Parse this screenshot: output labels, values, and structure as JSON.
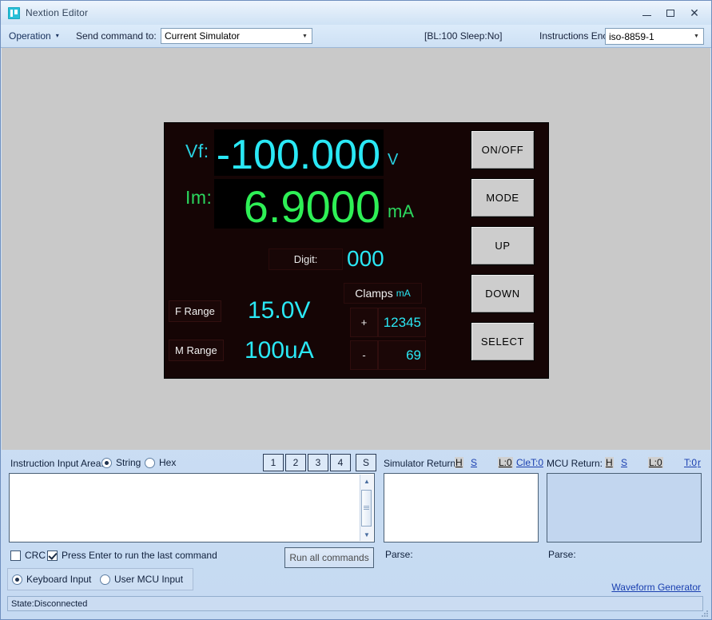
{
  "window": {
    "title": "Nextion Editor",
    "icon": "nextion-logo-icon",
    "minimize": "—",
    "maximize": "□",
    "close": "✕"
  },
  "toolbar": {
    "operation_menu": "Operation",
    "caret": "▾",
    "send_command_label": "Send command to:",
    "target_value": "Current Simulator",
    "status_info": "[BL:100  Sleep:No]",
    "encoding_label": "Instructions Encoding:",
    "encoding_value": "iso-8859-1",
    "combo_arrow": "▼"
  },
  "simulator": {
    "vf_label": "Vf:",
    "vf_value": "-100.000",
    "vf_unit": "V",
    "im_label": "Im:",
    "im_value": "6.9000",
    "im_unit": "mA",
    "digit_label": "Digit:",
    "digit_value": "000",
    "clamps_label": "Clamps",
    "clamps_unit": "mA",
    "clamp_plus_sign": "+",
    "clamp_plus_value": "12345",
    "clamp_minus_sign": "-",
    "clamp_minus_value": "69",
    "f_range_label": "F Range",
    "f_range_value": "15.0V",
    "m_range_label": "M Range",
    "m_range_value": "100uA",
    "buttons": [
      {
        "label": "ON/OFF"
      },
      {
        "label": "MODE"
      },
      {
        "label": "UP"
      },
      {
        "label": "DOWN"
      },
      {
        "label": "SELECT"
      }
    ],
    "colors": {
      "screen_bg": "#150505",
      "cyan": "#2ae8f5",
      "green": "#2ef056",
      "button_face": "#cdcdcd"
    }
  },
  "instruction_panel": {
    "label": "Instruction Input Area:",
    "mode_string": "String",
    "mode_hex": "Hex",
    "selected_mode": "String",
    "input_value": "",
    "quick_buttons": [
      "1",
      "2",
      "3",
      "4",
      "S"
    ],
    "scroll_up": "▲",
    "scroll_down": "▼"
  },
  "simulator_return": {
    "label": "Simulator Return:",
    "btn_h": "H",
    "btn_s": "S",
    "len": "L:0",
    "clear": "Cle",
    "time": "T:0",
    "content": "",
    "parse_label": "Parse:"
  },
  "mcu_return": {
    "label": "MCU Return:",
    "btn_h": "H",
    "btn_s": "S",
    "len": "L:0",
    "time": "T:0",
    "extra": "r",
    "content": "",
    "parse_label": "Parse:"
  },
  "options": {
    "crc_label": "CRC",
    "crc_checked": false,
    "enter_label": "Press Enter to run the last command",
    "enter_checked": true,
    "run_all_label": "Run all commands",
    "keyboard_input": "Keyboard Input",
    "user_mcu_input": "User MCU Input",
    "selected_input": "Keyboard Input",
    "waveform_generator": "Waveform Generator"
  },
  "status": {
    "text": "State:Disconnected"
  }
}
